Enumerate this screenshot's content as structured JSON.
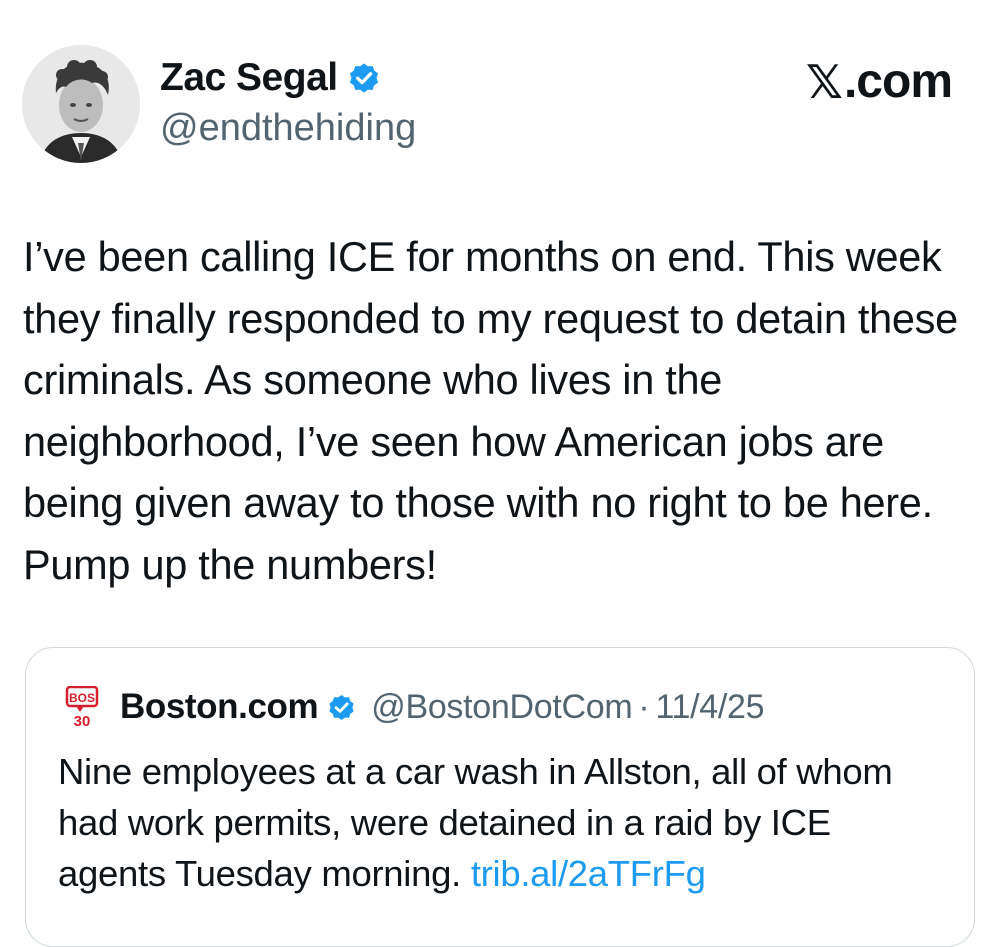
{
  "post": {
    "author": {
      "name": "Zac Segal",
      "handle": "@endthehiding",
      "verified_color": "#1d9bf0"
    },
    "brand": {
      "mark": "𝕏",
      "suffix": ".com"
    },
    "text": "I’ve been calling ICE for months on end. This week they finally responded to my request to detain these criminals. As someone who lives in the neighborhood, I’ve seen how American jobs are being given away to those with no right to be here. Pump up the numbers!"
  },
  "quote": {
    "logo": {
      "top": "BOS",
      "bottom": "30",
      "color": "#d61f2c"
    },
    "author_name": "Boston.com",
    "handle": "@BostonDotCom",
    "separator": "·",
    "date": "11/4/25",
    "text": "Nine employees at a car wash in Allston, all of whom had work permits, were detained in a raid by ICE agents Tuesday morning.",
    "link": "trib.al/2aTFrFg"
  },
  "colors": {
    "text_primary": "#0f1419",
    "text_secondary": "#536471",
    "accent": "#1d9bf0",
    "border": "#cfd9de"
  }
}
